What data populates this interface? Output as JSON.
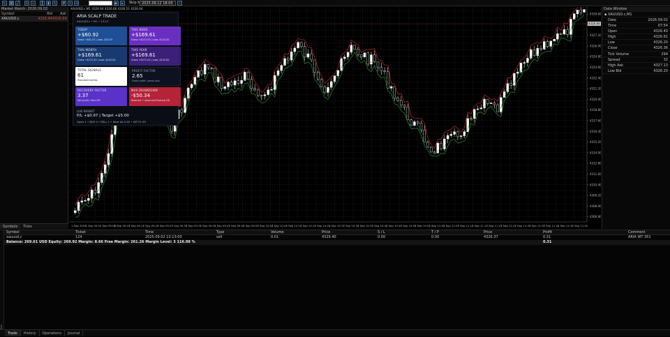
{
  "toolbar": {
    "symbol_field": "",
    "date_field": "2025.09.12 18:00",
    "shift_label": "Skip to"
  },
  "market_watch": {
    "title": "Market Watch: 2026.09.02",
    "cols": [
      "Symbol",
      "Bid",
      "Ask"
    ],
    "rows": [
      {
        "symbol": "XAUUSD.c",
        "bid": "4326.64",
        "ask": "4326.64"
      }
    ],
    "tabs": [
      "Symbols",
      "Ticks"
    ]
  },
  "chart": {
    "header": "XAUUSD.c,M1  4326.64 4326.66 4326.51 4326.64",
    "price_labels": [
      "4329.60",
      "4328.40",
      "4327.20",
      "4326.00",
      "4324.80",
      "4323.60",
      "4322.40",
      "4321.20",
      "4320.00",
      "4318.80",
      "4317.60",
      "4316.40",
      "4315.20",
      "4314.00",
      "4312.80",
      "4311.60",
      "4310.40",
      "4309.20",
      "4308.00",
      "4306.80"
    ],
    "current_price": "4326.64",
    "time_labels": [
      "1 Sep 2025",
      "1 Sep 09:01",
      "1 Sep 09:06",
      "1 Sep 09:13",
      "1 Sep 09:17",
      "1 Sep 09:22",
      "1 Sep 09:27",
      "1 Sep 09:32",
      "1 Sep 09:37",
      "1 Sep 09:42",
      "1 Sep 09:47",
      "1 Sep 09:52",
      "1 Sep 09:57",
      "1 Sep 10:02",
      "1 Sep 10:07",
      "1 Sep 10:12",
      "1 Sep 10:17",
      "1 Sep 10:22",
      "1 Sep 10:27",
      "1 Sep 10:32",
      "1 Sep 10:37",
      "1 Sep 10:42",
      "1 Sep 10:47",
      "1 Sep 10:52",
      "1 Sep 10:57",
      "1 Sep 11:02",
      "1 Sep 11:07",
      "1 Sep 11:12",
      "1 Sep 11:17",
      "1 Sep 11:22",
      "1 Sep 11:27",
      "1 Sep 11:32",
      "1 Sep 11:37",
      "1 Sep 11:42",
      "1 Sep 11:47",
      "1 Sep 11:52"
    ]
  },
  "panel": {
    "title": "ARIA SCALP TRADE",
    "subtitle": "XAUUSD.c  •  M1  •  13:13",
    "cards": [
      {
        "label": "TODAY",
        "value": "+$60.92",
        "sub": "Gross +$81.47  |  Loss -$20.55",
        "color": "#1f4f96"
      },
      {
        "label": "THIS WEEK",
        "value": "+$169.61",
        "sub": "Gross +$272.43  |  Loss -$102.82",
        "color": "#6a2fc0"
      },
      {
        "label": "THIS MONTH",
        "value": "+$169.61",
        "sub": "Gross +$272.43  |  Loss -$102.82",
        "color": "#183a70"
      },
      {
        "label": "THIS YEAR",
        "value": "+$169.61",
        "sub": "Gross +$272.43  |  Loss -$102.82",
        "color": "#3c1f78"
      },
      {
        "label": "TOTAL SIGNALS",
        "value": "61",
        "sub": "Executed entries",
        "color": "#ffffff"
      },
      {
        "label": "PROFIT FACTOR",
        "value": "2.65",
        "sub": "Gross profit / gross loss",
        "color": "#0e1220"
      },
      {
        "label": "RECOVERY FACTOR",
        "value": "3.37",
        "sub": "Net profit / Max DD",
        "color": "#5a32c8"
      },
      {
        "label": "MAX DRAWDOWN",
        "value": "-$50.34",
        "sub": "Realized + observed floating DD",
        "color": "#b62238"
      }
    ],
    "live": {
      "label": "LIVE BASKET",
      "line1": "P/L +$0.97  |  Target +$5.00",
      "line2": "Open 1  •  BUY 0  •  SELL 1  •  Next lot 0.02  •  WT:71.59"
    }
  },
  "data_window": {
    "title": "Data Window",
    "symbol": "XAUUSD.c,M1",
    "rows": [
      [
        "Date",
        "2026.09.02"
      ],
      [
        "Time",
        "07:54"
      ],
      [
        "Open",
        "4326.40"
      ],
      [
        "High",
        "4326.61"
      ],
      [
        "Low",
        "4326.20"
      ],
      [
        "Close",
        "4326.36"
      ],
      [
        "Tick Volume",
        "294"
      ],
      [
        "Spread",
        "32"
      ],
      [
        "High Ask",
        "4327.13"
      ],
      [
        "Low Bid",
        "4326.20"
      ]
    ]
  },
  "trade": {
    "cols": [
      "Symbol",
      "Ticket",
      "Time",
      "Type",
      "Volume",
      "Price",
      "S / L",
      "T / P",
      "Price",
      "Profit",
      "Comment"
    ],
    "rows": [
      [
        "xauusd.c",
        "124",
        "2025.09.02 13:13:00",
        "sell",
        "0.01",
        "4329.40",
        "0.00",
        "0.00",
        "4326.37",
        "0.31",
        "ARIA WT 351"
      ]
    ],
    "balance": "Balance: 269.61 USD  Equity: 269.92  Margin: 8.66  Free Margin: 261.26  Margin Level: 3 116.98 %",
    "balance_profit": "0.31"
  },
  "bottom_tabs": [
    "Trade",
    "History",
    "Operations",
    "Journal"
  ],
  "side_label": "Toolbox"
}
